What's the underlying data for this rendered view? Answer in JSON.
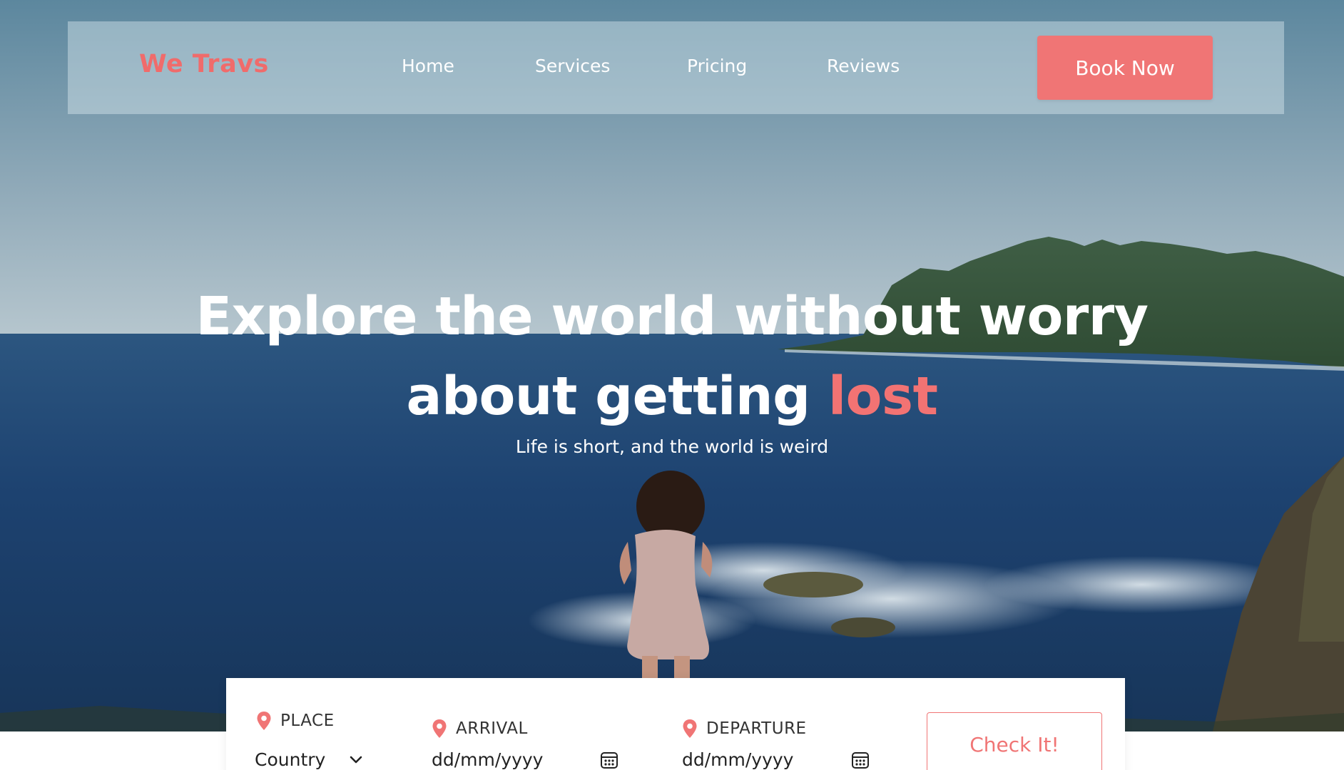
{
  "brand": "We Travs",
  "nav": {
    "links": [
      "Home",
      "Services",
      "Pricing",
      "Reviews"
    ],
    "cta": "Book Now"
  },
  "hero": {
    "title_line1": "Explore the world without worry",
    "title_line2_pre": "about getting ",
    "title_line2_accent": "lost",
    "subtitle": "Life is short, and the world is weird",
    "accent_color": "#f07575"
  },
  "booking": {
    "place": {
      "label": "PLACE",
      "value": "Country",
      "icon": "map-pin-icon"
    },
    "arrival": {
      "label": "ARRIVAL",
      "placeholder": "dd/mm/yyyy",
      "icon": "calendar-icon"
    },
    "departure": {
      "label": "DEPARTURE",
      "placeholder": "dd/mm/yyyy",
      "icon": "calendar-icon"
    },
    "submit": "Check It!"
  }
}
